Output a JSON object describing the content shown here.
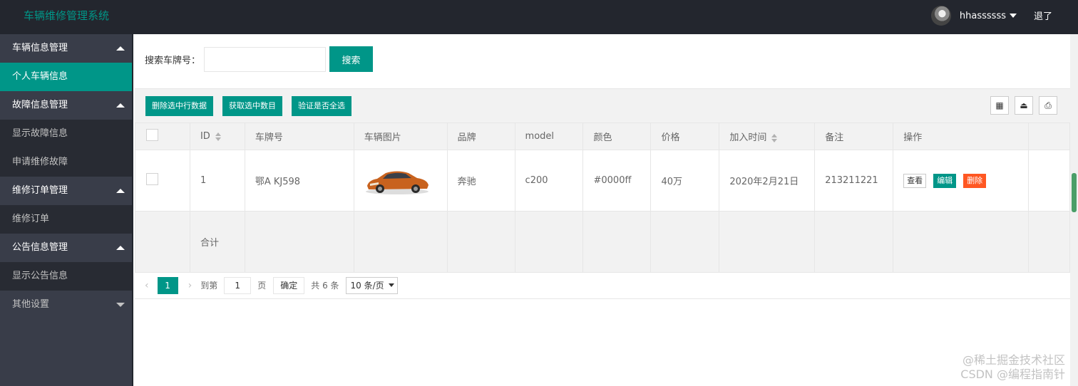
{
  "header": {
    "title": "车辆维修管理系统",
    "username": "hhassssss",
    "logout": "退了"
  },
  "sidebar": {
    "items": [
      {
        "label": "车辆信息管理",
        "type": "group",
        "arrow": "up"
      },
      {
        "label": "个人车辆信息",
        "type": "child",
        "active": true
      },
      {
        "label": "故障信息管理",
        "type": "group",
        "arrow": "up"
      },
      {
        "label": "显示故障信息",
        "type": "child"
      },
      {
        "label": "申请维修故障",
        "type": "child"
      },
      {
        "label": "维修订单管理",
        "type": "group",
        "arrow": "up"
      },
      {
        "label": "维修订单",
        "type": "child"
      },
      {
        "label": "公告信息管理",
        "type": "group",
        "arrow": "up"
      },
      {
        "label": "显示公告信息",
        "type": "child"
      },
      {
        "label": "其他设置",
        "type": "group",
        "arrow": "down"
      }
    ]
  },
  "search": {
    "label": "搜索车牌号：",
    "value": "",
    "button": "搜索"
  },
  "toolbar": {
    "buttons": [
      "删除选中行数据",
      "获取选中数目",
      "验证是否全选"
    ],
    "icons": [
      "grid-icon",
      "export-icon",
      "print-icon"
    ]
  },
  "table": {
    "columns": [
      "",
      "ID",
      "车牌号",
      "车辆图片",
      "品牌",
      "model",
      "颜色",
      "价格",
      "加入时间",
      "备注",
      "操作",
      ""
    ],
    "rows": [
      {
        "id": "1",
        "plate": "鄂A KJ598",
        "brand": "奔驰",
        "model": "c200",
        "color": "#0000ff",
        "price": "40万",
        "date": "2020年2月21日",
        "note": "213211221"
      }
    ],
    "total_label": "合计",
    "actions": {
      "view": "查看",
      "edit": "编辑",
      "delete": "删除"
    }
  },
  "pager": {
    "current": "1",
    "goto_label": "到第",
    "goto_value": "1",
    "page_unit": "页",
    "ok": "确定",
    "total": "共 6 条",
    "page_size": "10 条/页"
  },
  "watermark": {
    "line1": "@稀土掘金技术社区",
    "line2": "CSDN @编程指南针"
  }
}
